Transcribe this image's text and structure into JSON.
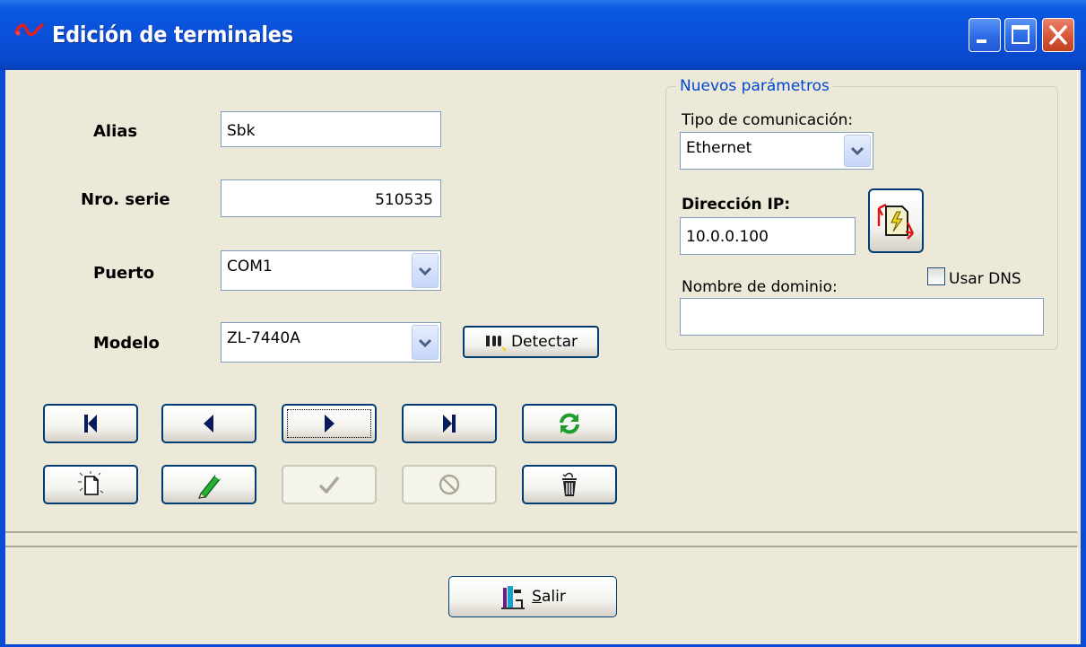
{
  "window": {
    "title": "Edición de terminales",
    "buttons": [
      "minimize",
      "maximize",
      "close"
    ]
  },
  "form": {
    "alias_label": "Alias",
    "alias_value": "Sbk",
    "serial_label": "Nro. serie",
    "serial_value": "510535",
    "port_label": "Puerto",
    "port_value": "COM1",
    "model_label": "Modelo",
    "model_value": "ZL-7440A",
    "detect_label": "Detectar"
  },
  "params": {
    "group_title": "Nuevos parámetros",
    "comm_type_label": "Tipo de comunicación:",
    "comm_type_value": "Ethernet",
    "ip_label": "Dirección IP:",
    "ip_value": "10.0.0.100",
    "domain_label": "Nombre de dominio:",
    "domain_value": "",
    "use_dns_label": "Usar DNS",
    "use_dns_checked": false
  },
  "nav_buttons": [
    {
      "name": "first-record",
      "icon": "skip-first-icon",
      "enabled": true
    },
    {
      "name": "previous-record",
      "icon": "triangle-left-icon",
      "enabled": true
    },
    {
      "name": "next-record",
      "icon": "triangle-right-icon",
      "enabled": true,
      "focused": true
    },
    {
      "name": "last-record",
      "icon": "skip-last-icon",
      "enabled": true
    },
    {
      "name": "refresh",
      "icon": "refresh-icon",
      "enabled": true
    }
  ],
  "edit_buttons": [
    {
      "name": "new-record",
      "icon": "new-document-icon",
      "enabled": true
    },
    {
      "name": "edit-record",
      "icon": "pencil-icon",
      "enabled": true
    },
    {
      "name": "confirm",
      "icon": "checkmark-icon",
      "enabled": false
    },
    {
      "name": "cancel",
      "icon": "prohibited-icon",
      "enabled": false
    },
    {
      "name": "delete-record",
      "icon": "trash-icon",
      "enabled": true
    }
  ],
  "footer": {
    "exit_label_accel": "S",
    "exit_label_rest": "alir"
  },
  "colors": {
    "titlebar": "#0a4fd8",
    "window_bg": "#ece9d8",
    "button_border": "#003c74",
    "group_title": "#0046d5",
    "refresh_green": "#1f9e2d"
  }
}
